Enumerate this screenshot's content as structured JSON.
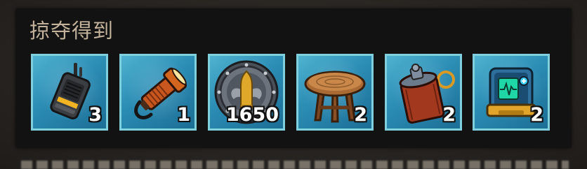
{
  "panel": {
    "title": "掠夺得到"
  },
  "items": [
    {
      "icon": "walkie-talkie-icon",
      "count": "3"
    },
    {
      "icon": "flashlight-icon",
      "count": "1"
    },
    {
      "icon": "bullet-shield-icon",
      "count": "1650"
    },
    {
      "icon": "wooden-stool-icon",
      "count": "2"
    },
    {
      "icon": "canister-grenade-icon",
      "count": "2"
    },
    {
      "icon": "medical-device-icon",
      "count": "2"
    }
  ],
  "colors": {
    "title": "#c3b29b",
    "slot_border": "#7fd0dc",
    "slot_bg": "#2b8cb4",
    "panel_bg": "#121212"
  }
}
